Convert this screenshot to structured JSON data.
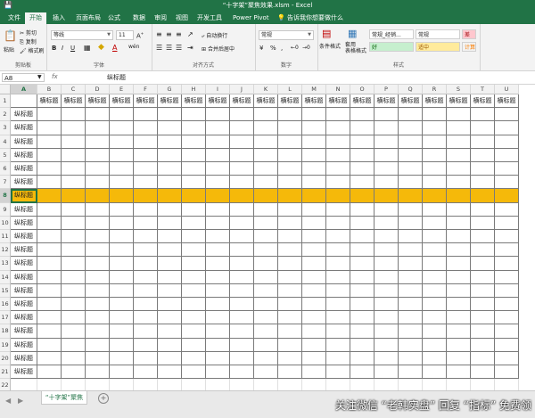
{
  "window": {
    "title": "“十字架”聚焦效果.xlsm  -  Excel"
  },
  "menu": {
    "tabs": [
      "文件",
      "开始",
      "插入",
      "页面布局",
      "公式",
      "数据",
      "审阅",
      "视图",
      "开发工具",
      "Power Pivot"
    ],
    "active": "开始",
    "tell_me": "告诉我你想要做什么"
  },
  "ribbon": {
    "clipboard": {
      "paste": "粘贴",
      "cut": "剪切",
      "copy": "复制",
      "painter": "格式刷",
      "label": "剪贴板"
    },
    "font": {
      "name": "等线",
      "size": "11",
      "bold": "B",
      "italic": "I",
      "underline": "U",
      "wen": "wén",
      "label": "字体"
    },
    "align": {
      "wrap": "自动换行",
      "merge": "合并后居中",
      "label": "对齐方式"
    },
    "number": {
      "format": "常规",
      "pct": "%",
      "comma": ",",
      "label": "数字"
    },
    "styles": {
      "cond": "条件格式",
      "table": "套用\n表格格式",
      "cells": [
        {
          "label": "常规_经销...",
          "bg": "#ffffff",
          "fg": "#222222"
        },
        {
          "label": "常规",
          "bg": "#ffffff",
          "fg": "#222222"
        },
        {
          "label": "差",
          "bg": "#ffc7ce",
          "fg": "#9c0006"
        },
        {
          "label": "好",
          "bg": "#c6efce",
          "fg": "#006100"
        },
        {
          "label": "适中",
          "bg": "#ffeb9c",
          "fg": "#9c5700"
        },
        {
          "label": "计算",
          "bg": "#f2f2f2",
          "fg": "#fa7d00"
        }
      ],
      "label": "样式"
    }
  },
  "formula_bar": {
    "name_box": "A8",
    "fx": "fx",
    "content": "纵标题"
  },
  "sheet": {
    "columns": [
      "A",
      "B",
      "C",
      "D",
      "E",
      "F",
      "G",
      "H",
      "I",
      "J",
      "K",
      "L",
      "M",
      "N",
      "O",
      "P",
      "Q",
      "R",
      "S",
      "T",
      "U"
    ],
    "header_row_text": "横标题",
    "row_header_text": "纵标题",
    "rows": [
      1,
      2,
      3,
      4,
      5,
      6,
      7,
      8,
      9,
      10,
      11,
      12,
      13,
      14,
      15,
      16,
      17,
      18,
      19,
      20,
      21,
      22
    ],
    "highlight_row": 8,
    "highlight_color": "#f5b90a"
  },
  "sheet_tabs": {
    "active": "“十字架”聚焦"
  },
  "watermark": "关注微信 “老韩实盘” 回复 “指标” 免费领"
}
